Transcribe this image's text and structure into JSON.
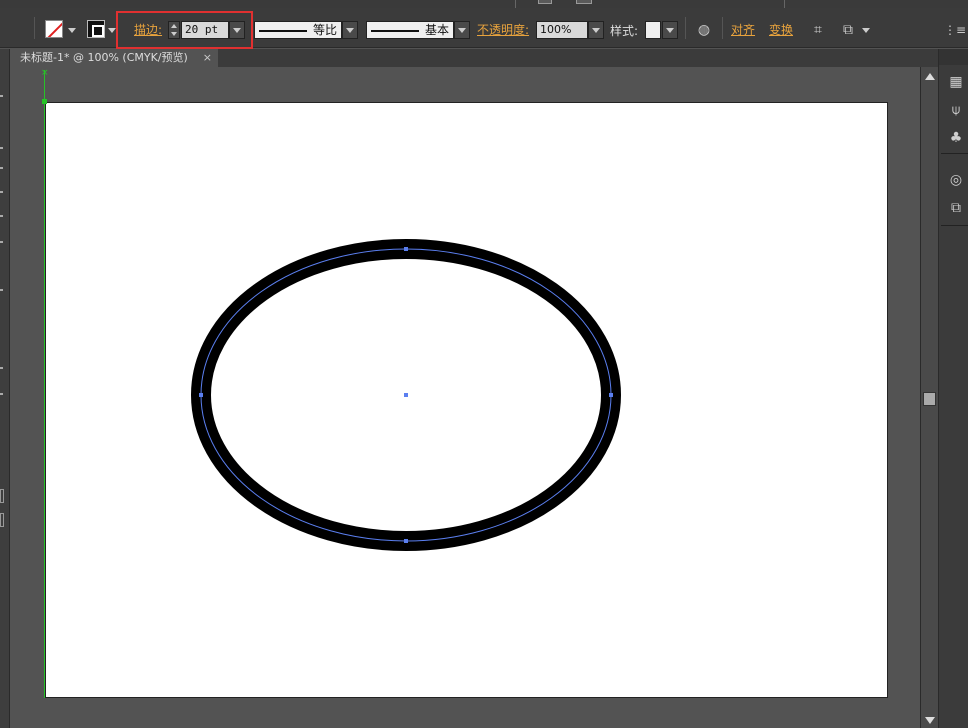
{
  "control_bar": {
    "stroke_label": "描边:",
    "stroke_weight": "20 pt",
    "profile_label": "等比",
    "brush_label": "基本",
    "opacity_label": "不透明度:",
    "opacity_value": "100%",
    "style_label": "样式:",
    "align_label": "对齐",
    "transform_label": "变换"
  },
  "document": {
    "tab_title": "未标题-1* @ 100% (CMYK/预览)",
    "tab_close": "×"
  },
  "guide": {
    "marker": "×"
  },
  "icons": {
    "fill": "fill-none-swatch-icon",
    "stroke": "stroke-swatch-icon",
    "recolor": "recolor-artwork-icon",
    "isolate": "isolate-selected-object-icon",
    "select_similar": "select-similar-objects-icon",
    "panel_menu": "panel-menu-icon",
    "swatches": "swatches-panel-icon",
    "brushes": "brushes-panel-icon",
    "symbols": "symbols-panel-icon",
    "appearance": "appearance-panel-icon",
    "transform": "transform-panel-icon"
  },
  "colors": {
    "highlight": "#e03030",
    "guide": "#27c227",
    "path": "#5b7ff0",
    "stroke": "#000000",
    "link": "#e8a33d"
  }
}
